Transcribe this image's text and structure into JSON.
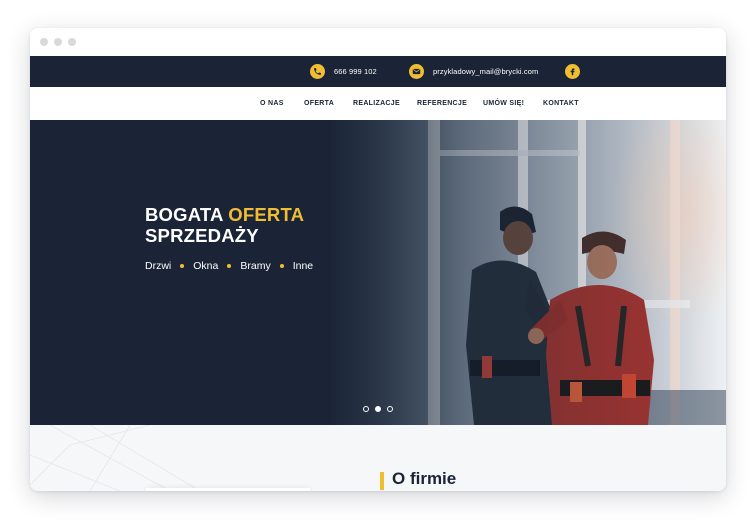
{
  "colors": {
    "navy": "#1a2436",
    "accent": "#f0be32",
    "white": "#ffffff"
  },
  "topbar": {
    "phone": {
      "icon": "phone-icon",
      "text": "666 999 102"
    },
    "email": {
      "icon": "mail-icon",
      "text": "przykladowy_mail@brycki.com"
    },
    "facebook": {
      "icon": "facebook-icon"
    }
  },
  "nav": {
    "items": [
      {
        "label": "O NAS"
      },
      {
        "label": "OFERTA"
      },
      {
        "label": "REALIZACJE"
      },
      {
        "label": "REFERENCJE"
      },
      {
        "label": "UMÓW SIĘ!"
      },
      {
        "label": "KONTAKT"
      }
    ]
  },
  "hero": {
    "title_line1_white": "BOGATA",
    "title_line1_accent": "OFERTA",
    "title_line2": "SPRZEDAŻY",
    "categories": [
      "Drzwi",
      "Okna",
      "Bramy",
      "Inne"
    ],
    "slides": {
      "count": 3,
      "active": 2
    }
  },
  "about": {
    "title": "O firmie"
  }
}
